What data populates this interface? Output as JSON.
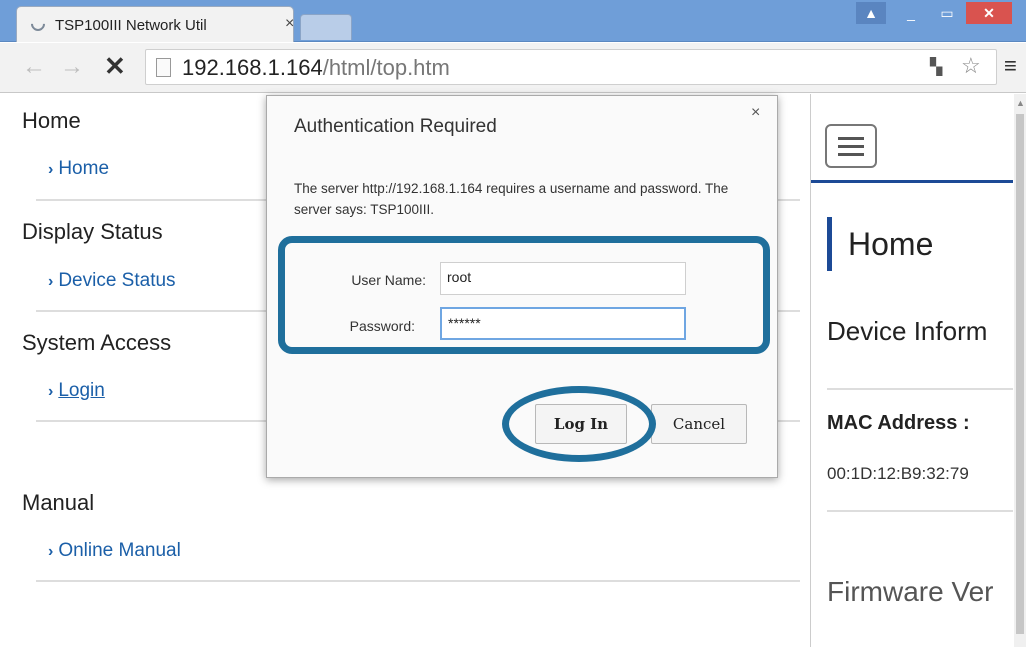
{
  "browser": {
    "tab_title": "TSP100III Network Util",
    "tab_close": "×",
    "url_host": "192.168.1.164",
    "url_path": "/html/top.htm",
    "window_controls": {
      "user": "▲",
      "minimize": "_",
      "maximize": "▭",
      "close": "✕"
    },
    "nav": {
      "back": "←",
      "forward": "→",
      "stop": "✕"
    },
    "icons": [
      "page-icon",
      "translate-icon",
      "star-icon",
      "menu-icon",
      "loading-spinner-icon"
    ]
  },
  "leftnav": {
    "sections": [
      {
        "title": "Home",
        "link": "Home"
      },
      {
        "title": "Display Status",
        "link": "Device Status"
      },
      {
        "title": "System Access",
        "link": "Login"
      },
      {
        "title": "Manual",
        "link": "Online Manual"
      }
    ]
  },
  "rightpane": {
    "heading": "Home",
    "device_info": "Device Inform",
    "mac_label": "MAC Address :",
    "mac_value": "00:1D:12:B9:32:79",
    "firmware": "Firmware Ver"
  },
  "dialog": {
    "title": "Authentication Required",
    "close": "×",
    "message": "The server http://192.168.1.164 requires a username and password. The server says: TSP100III.",
    "username_label": "User Name:",
    "username_value": "root",
    "password_label": "Password:",
    "password_value": "******",
    "login_label": "Log In",
    "cancel_label": "Cancel"
  },
  "colors": {
    "highlight": "#1f6f9c",
    "link": "#1b5fa8",
    "accent_bar": "#1c4a96",
    "titlebar": "#6f9ed8"
  }
}
